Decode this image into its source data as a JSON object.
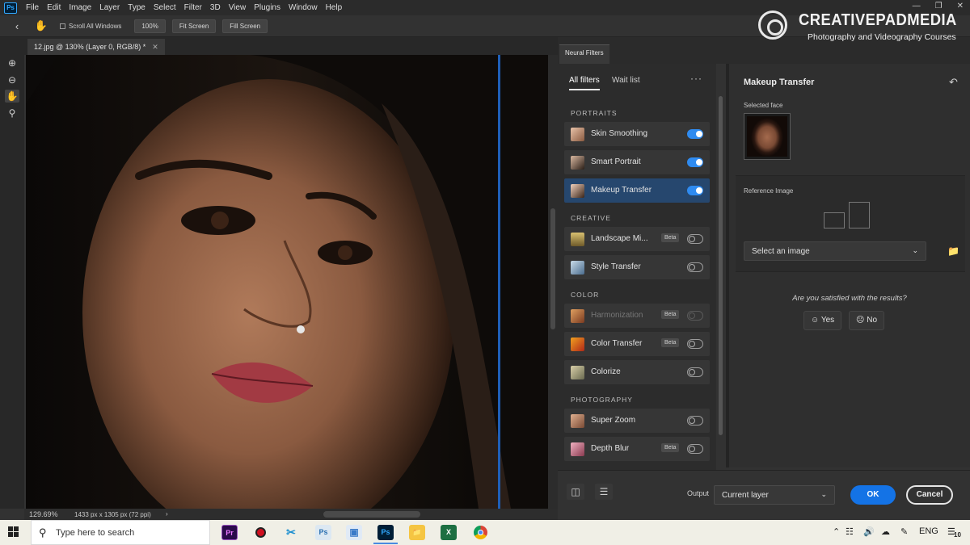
{
  "menubar": {
    "items": [
      "File",
      "Edit",
      "Image",
      "Layer",
      "Type",
      "Select",
      "Filter",
      "3D",
      "View",
      "Plugins",
      "Window",
      "Help"
    ],
    "logo": "Ps"
  },
  "options": {
    "scroll_all_windows": "Scroll All Windows",
    "zoom_100": "100%",
    "fit_screen": "Fit Screen",
    "fill_screen": "Fill Screen"
  },
  "document": {
    "tab_title": "12.jpg @ 130% (Layer 0, RGB/8) *",
    "zoom_readout": "129.69%",
    "dimensions": "1433 px x 1305 px (72 ppi)"
  },
  "neural_filters": {
    "panel_tab": "Neural Filters",
    "tab_all": "All filters",
    "tab_wait": "Wait list",
    "more": "···",
    "sections": {
      "portraits": "PORTRAITS",
      "creative": "CREATIVE",
      "color": "COLOR",
      "photography": "PHOTOGRAPHY"
    },
    "filters": [
      {
        "label": "Skin Smoothing",
        "on": true,
        "beta": "",
        "dim": false
      },
      {
        "label": "Smart Portrait",
        "on": true,
        "beta": "",
        "dim": false
      },
      {
        "label": "Makeup Transfer",
        "on": true,
        "beta": "",
        "dim": false,
        "active": true
      },
      {
        "label": "Landscape Mi...",
        "on": false,
        "beta": "Beta",
        "dim": false
      },
      {
        "label": "Style Transfer",
        "on": false,
        "beta": "",
        "dim": false
      },
      {
        "label": "Harmonization",
        "on": false,
        "beta": "Beta",
        "dim": true
      },
      {
        "label": "Color Transfer",
        "on": false,
        "beta": "Beta",
        "dim": false
      },
      {
        "label": "Colorize",
        "on": false,
        "beta": "",
        "dim": false
      },
      {
        "label": "Super Zoom",
        "on": false,
        "beta": "",
        "dim": false
      },
      {
        "label": "Depth Blur",
        "on": false,
        "beta": "Beta",
        "dim": false
      }
    ],
    "detail": {
      "title": "Makeup Transfer",
      "selected_face": "Selected face",
      "reference_image": "Reference Image",
      "select_image": "Select an image",
      "satisfied": "Are you satisfied with the results?",
      "yes": "Yes",
      "no": "No"
    },
    "footer": {
      "output_label": "Output",
      "output_value": "Current layer",
      "ok": "OK",
      "cancel": "Cancel"
    }
  },
  "watermark": {
    "brand": "CREATIVEPADMEDIA",
    "subtitle": "Photography and Videography Courses"
  },
  "taskbar": {
    "search_placeholder": "Type here to search",
    "apps": [
      "Pr",
      "Ps",
      "Ps"
    ],
    "language": "ENG",
    "notification_count": "10"
  },
  "colors": {
    "accent": "#1473e6",
    "toggle_on": "#2f8bf0",
    "active_row": "#26476e"
  }
}
